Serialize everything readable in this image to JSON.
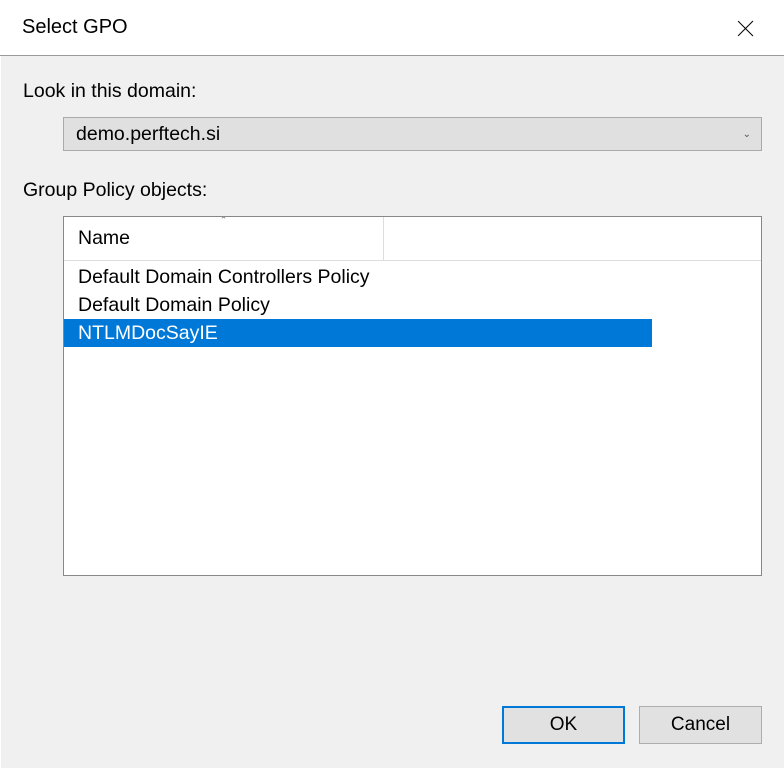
{
  "title": "Select GPO",
  "lookInLabel": "Look in this domain:",
  "domainValue": "demo.perftech.si",
  "gpoLabel": "Group Policy objects:",
  "columnHeader": "Name",
  "items": [
    {
      "name": "Default Domain Controllers Policy",
      "selected": false
    },
    {
      "name": "Default Domain Policy",
      "selected": false
    },
    {
      "name": "NTLMDocSayIE",
      "selected": true
    }
  ],
  "buttons": {
    "ok": "OK",
    "cancel": "Cancel"
  }
}
